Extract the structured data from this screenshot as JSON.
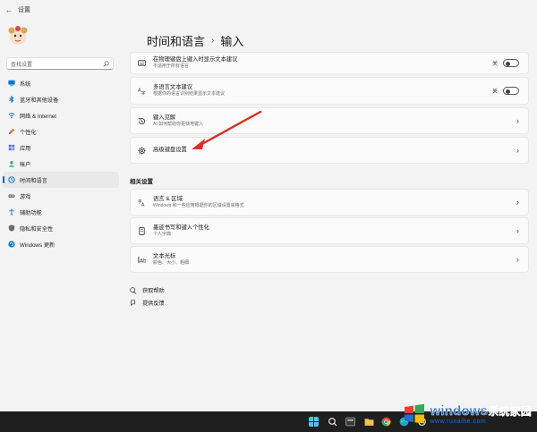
{
  "window": {
    "title": "设置"
  },
  "sidebar": {
    "search_placeholder": "查找设置",
    "items": [
      {
        "label": "系统",
        "icon": "monitor-icon",
        "color": "#0078d4",
        "active": false
      },
      {
        "label": "蓝牙和其他设备",
        "icon": "bluetooth-icon",
        "color": "#0078d4",
        "active": false
      },
      {
        "label": "网络 & Internet",
        "icon": "wifi-icon",
        "color": "#0067c0",
        "active": false
      },
      {
        "label": "个性化",
        "icon": "brush-icon",
        "color": "#e36c3b",
        "active": false
      },
      {
        "label": "应用",
        "icon": "apps-icon",
        "color": "#4c6ef5",
        "active": false
      },
      {
        "label": "帐户",
        "icon": "account-icon",
        "color": "#2fb26b",
        "active": false
      },
      {
        "label": "时间和语言",
        "icon": "clock-globe-icon",
        "color": "#0078d4",
        "active": true
      },
      {
        "label": "游戏",
        "icon": "gamepad-icon",
        "color": "#7b7b7b",
        "active": false
      },
      {
        "label": "辅助功能",
        "icon": "accessibility-icon",
        "color": "#3a7bd5",
        "active": false
      },
      {
        "label": "隐私和安全性",
        "icon": "shield-icon",
        "color": "#6b6b6b",
        "active": false
      },
      {
        "label": "Windows 更新",
        "icon": "update-icon",
        "color": "#0078d4",
        "active": false
      }
    ]
  },
  "main": {
    "breadcrumb": {
      "parent": "时间和语言",
      "separator": "›",
      "current": "输入"
    },
    "cards": [
      {
        "title": "在物理键盘上键入时显示文本建议",
        "desc": "不适用于所有语言",
        "icon": "keyboard-icon",
        "toggle_label": "关"
      },
      {
        "title": "多语言文本建议",
        "desc": "根据你的语言识别结果显示文本建议",
        "icon": "multilang-icon",
        "toggle_label": "关"
      },
      {
        "title": "键入见解",
        "desc": "AI 如何帮助你更快地键入",
        "icon": "history-icon"
      },
      {
        "title": "高级键盘设置",
        "desc": "",
        "icon": "gear-icon"
      }
    ],
    "related_title": "相关设置",
    "related": [
      {
        "title": "语言 & 区域",
        "desc": "Windows 和一些应用根据你的区域设置来格式",
        "icon": "language-icon"
      },
      {
        "title": "墨迹书写和键入个性化",
        "desc": "个人字典",
        "icon": "ink-icon"
      },
      {
        "title": "文本光标",
        "desc": "颜色、大小、粗细",
        "icon": "text-cursor-icon"
      }
    ],
    "help_links": [
      {
        "label": "获取帮助",
        "icon": "help-icon"
      },
      {
        "label": "提供反馈",
        "icon": "feedback-icon"
      }
    ]
  },
  "annotation": {
    "color": "#d93025"
  },
  "taskbar": {
    "icons": [
      "start-icon",
      "search-icon",
      "explorer-icon",
      "folder-icon",
      "chrome-icon",
      "edge-icon",
      "settings-icon"
    ]
  },
  "watermark": {
    "brand": "windows",
    "brand_suffix": "系统家园",
    "sub": "www.runaihe.com"
  }
}
